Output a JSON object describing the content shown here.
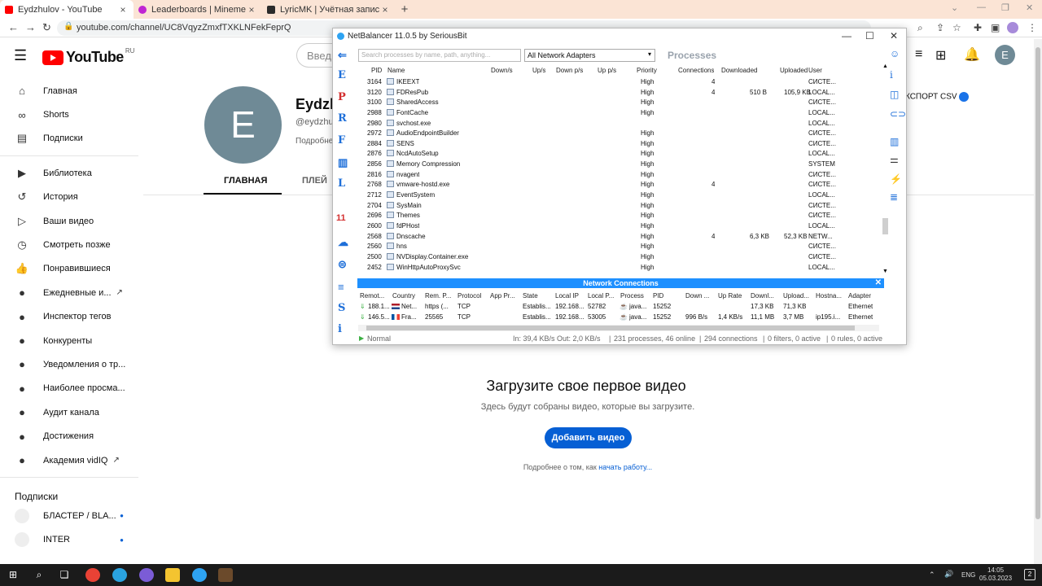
{
  "browser": {
    "tabs": [
      {
        "title": "Eydzhulov - YouTube",
        "fav_color": "#ff0000",
        "active": true
      },
      {
        "title": "Leaderboards | Minemen Club",
        "fav_color": "#c026d3",
        "active": false
      },
      {
        "title": "LyricMK | Учётная запись Mine",
        "fav_color": "#2b2b2b",
        "active": false
      }
    ],
    "url": "youtube.com/channel/UC8VqyzZmxfTXKLNFekFeprQ"
  },
  "youtube": {
    "logo_text": "YouTube",
    "logo_region": "RU",
    "search_placeholder": "Введи",
    "sidebar": {
      "main": [
        {
          "label": "Главная",
          "icon": "home-icon"
        },
        {
          "label": "Shorts",
          "icon": "shorts-icon"
        },
        {
          "label": "Подписки",
          "icon": "subscriptions-icon"
        }
      ],
      "library": [
        {
          "label": "Библиотека",
          "icon": "library-icon"
        },
        {
          "label": "История",
          "icon": "history-icon"
        },
        {
          "label": "Ваши видео",
          "icon": "your-videos-icon"
        },
        {
          "label": "Смотреть позже",
          "icon": "watch-later-icon"
        },
        {
          "label": "Понравившиеся",
          "icon": "liked-icon"
        }
      ],
      "vidiq": [
        {
          "label": "Ежедневные и...",
          "ext": true
        },
        {
          "label": "Инспектор тегов",
          "ext": false
        },
        {
          "label": "Конкуренты",
          "ext": false
        },
        {
          "label": "Уведомления о тр...",
          "ext": false
        },
        {
          "label": "Наиболее просма...",
          "ext": false
        },
        {
          "label": "Аудит канала",
          "ext": false
        },
        {
          "label": "Достижения",
          "ext": false
        },
        {
          "label": "Академия vidIQ",
          "ext": true
        }
      ],
      "subscriptions_heading": "Подписки",
      "subscriptions": [
        {
          "label": "БЛАСТЕР / BLA..."
        },
        {
          "label": "INTER"
        }
      ]
    },
    "channel": {
      "avatar_letter": "E",
      "name": "Eydzh",
      "handle": "@eydzhulo",
      "more": "Подробне",
      "tab_home": "ГЛАВНАЯ",
      "tab_playlists": "ПЛЕЙ",
      "export_label": "КСПОРТ CSV"
    },
    "empty": {
      "title": "Загрузите свое первое видео",
      "subtitle": "Здесь будут собраны видео, которые вы загрузите.",
      "button": "Добавить видео",
      "more_prefix": "Подробнее о том, как ",
      "more_link": "начать работу..."
    },
    "user_avatar": "E"
  },
  "netbalancer": {
    "title": "NetBalancer 11.0.5 by SeriousBit",
    "search_placeholder": "Search processes by name, path, anything...",
    "adapter_select": "All Network Adapters",
    "processes_label": "Processes",
    "left_icons": [
      "E",
      "P",
      "R",
      "F",
      "L",
      "11",
      "S",
      "i"
    ],
    "columns": [
      "PID",
      "Name",
      "Down/s",
      "Up/s",
      "Down p/s",
      "Up p/s",
      "Priority",
      "Connections",
      "Downloaded",
      "Uploaded",
      "User"
    ],
    "rows": [
      {
        "pid": "3164",
        "name": "IKEEXT",
        "priority": "High",
        "conn": "4",
        "down": "",
        "up": "",
        "user": "СИСТЕ..."
      },
      {
        "pid": "3120",
        "name": "FDResPub",
        "priority": "High",
        "conn": "4",
        "down": "510 B",
        "up": "105,9 KB",
        "user": "LOCAL..."
      },
      {
        "pid": "3100",
        "name": "SharedAccess",
        "priority": "High",
        "conn": "",
        "down": "",
        "up": "",
        "user": "СИСТЕ..."
      },
      {
        "pid": "2988",
        "name": "FontCache",
        "priority": "High",
        "conn": "",
        "down": "",
        "up": "",
        "user": "LOCAL..."
      },
      {
        "pid": "2980",
        "name": "svchost.exe",
        "priority": "",
        "conn": "",
        "down": "",
        "up": "",
        "user": "LOCAL..."
      },
      {
        "pid": "2972",
        "name": "AudioEndpointBuilder",
        "priority": "High",
        "conn": "",
        "down": "",
        "up": "",
        "user": "СИСТЕ..."
      },
      {
        "pid": "2884",
        "name": "SENS",
        "priority": "High",
        "conn": "",
        "down": "",
        "up": "",
        "user": "СИСТЕ..."
      },
      {
        "pid": "2876",
        "name": "NcdAutoSetup",
        "priority": "High",
        "conn": "",
        "down": "",
        "up": "",
        "user": "LOCAL..."
      },
      {
        "pid": "2856",
        "name": "Memory Compression",
        "priority": "High",
        "conn": "",
        "down": "",
        "up": "",
        "user": "SYSTEM"
      },
      {
        "pid": "2816",
        "name": "nvagent",
        "priority": "High",
        "conn": "",
        "down": "",
        "up": "",
        "user": "СИСТЕ..."
      },
      {
        "pid": "2768",
        "name": "vmware-hostd.exe",
        "priority": "High",
        "conn": "4",
        "down": "",
        "up": "",
        "user": "СИСТЕ..."
      },
      {
        "pid": "2712",
        "name": "EventSystem",
        "priority": "High",
        "conn": "",
        "down": "",
        "up": "",
        "user": "LOCAL..."
      },
      {
        "pid": "2704",
        "name": "SysMain",
        "priority": "High",
        "conn": "",
        "down": "",
        "up": "",
        "user": "СИСТЕ..."
      },
      {
        "pid": "2696",
        "name": "Themes",
        "priority": "High",
        "conn": "",
        "down": "",
        "up": "",
        "user": "СИСТЕ..."
      },
      {
        "pid": "2600",
        "name": "fdPHost",
        "priority": "High",
        "conn": "",
        "down": "",
        "up": "",
        "user": "LOCAL..."
      },
      {
        "pid": "2568",
        "name": "Dnscache",
        "priority": "High",
        "conn": "4",
        "down": "6,3 KB",
        "up": "52,3 KB",
        "user": "NETW..."
      },
      {
        "pid": "2560",
        "name": "hns",
        "priority": "High",
        "conn": "",
        "down": "",
        "up": "",
        "user": "СИСТЕ..."
      },
      {
        "pid": "2500",
        "name": "NVDisplay.Container.exe",
        "priority": "High",
        "conn": "",
        "down": "",
        "up": "",
        "user": "СИСТЕ..."
      },
      {
        "pid": "2452",
        "name": "WinHttpAutoProxySvc",
        "priority": "High",
        "conn": "",
        "down": "",
        "up": "",
        "user": "LOCAL..."
      }
    ],
    "connections_title": "Network Connections",
    "nc_columns": [
      "Remot...",
      "Country",
      "Rem. P...",
      "Protocol",
      "App Pr...",
      "State",
      "Local IP",
      "Local P...",
      "Process",
      "PID",
      "Down ...",
      "Up Rate",
      "Downl...",
      "Upload...",
      "Hostna...",
      "Adapter"
    ],
    "nc_rows": [
      {
        "remote": "188.1...",
        "country": "Net...",
        "rport": "https (...",
        "proto": "TCP",
        "state": "Establis...",
        "lip": "192.168...",
        "lport": "52782",
        "proc": "java...",
        "pid": "15252",
        "downr": "",
        "upr": "",
        "downl": "17,3 KB",
        "upl": "71,3 KB",
        "host": "",
        "adapter": "Ethernet"
      },
      {
        "remote": "146.5...",
        "country": "Fra...",
        "rport": "25565",
        "proto": "TCP",
        "state": "Establis...",
        "lip": "192.168...",
        "lport": "53005",
        "proc": "java...",
        "pid": "15252",
        "downr": "996 B/s",
        "upr": "1,4 KB/s",
        "downl": "11,1 MB",
        "upl": "3,7 MB",
        "host": "ip195.i...",
        "adapter": "Ethernet"
      }
    ],
    "status": {
      "mode": "Normal",
      "rates": "In: 39,4 KB/s  Out: 2,0 KB/s",
      "processes": "231 processes, 46 online",
      "connections": "294 connections",
      "filters": "0 filters, 0 active",
      "rules": "0 rules, 0 active"
    }
  },
  "taskbar": {
    "lang": "ENG",
    "time": "14:05",
    "date": "05.03.2023",
    "notifications": "2"
  }
}
